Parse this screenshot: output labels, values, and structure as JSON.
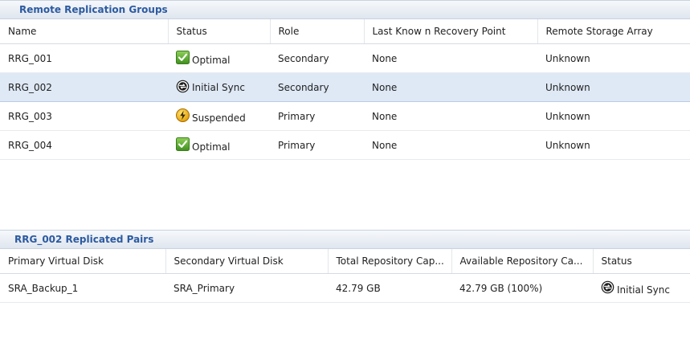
{
  "rrg_panel": {
    "title": "Remote Replication Groups",
    "columns": [
      "Name",
      "Status",
      "Role",
      "Last Know n Recovery Point",
      "Remote Storage Array"
    ],
    "rows": [
      {
        "name": "RRG_001",
        "status": "Optimal",
        "status_icon": "check-icon",
        "role": "Secondary",
        "recovery_point": "None",
        "remote_array": "Unknown"
      },
      {
        "name": "RRG_002",
        "status": "Initial Sync",
        "status_icon": "sync-icon",
        "role": "Secondary",
        "recovery_point": "None",
        "remote_array": "Unknown"
      },
      {
        "name": "RRG_003",
        "status": "Suspended",
        "status_icon": "suspended-icon",
        "role": "Primary",
        "recovery_point": "None",
        "remote_array": "Unknown"
      },
      {
        "name": "RRG_004",
        "status": "Optimal",
        "status_icon": "check-icon",
        "role": "Primary",
        "recovery_point": "None",
        "remote_array": "Unknown"
      }
    ]
  },
  "pairs_panel": {
    "title": "RRG_002 Replicated Pairs",
    "columns": [
      "Primary Virtual Disk",
      "Secondary Virtual Disk",
      "Total Repository Cap...",
      "Available Repository Ca...",
      "Status"
    ],
    "rows": [
      {
        "primary": "SRA_Backup_1",
        "secondary": "SRA_Primary",
        "total": "42.79 GB",
        "available": "42.79 GB (100%)",
        "status": "Initial Sync",
        "status_icon": "sync-icon"
      }
    ]
  },
  "colors": {
    "header_text": "#2c5aa0",
    "selected_row": "#dfe9f5",
    "check_green": "#5aa02c",
    "suspend_yellow": "#f2b705"
  }
}
